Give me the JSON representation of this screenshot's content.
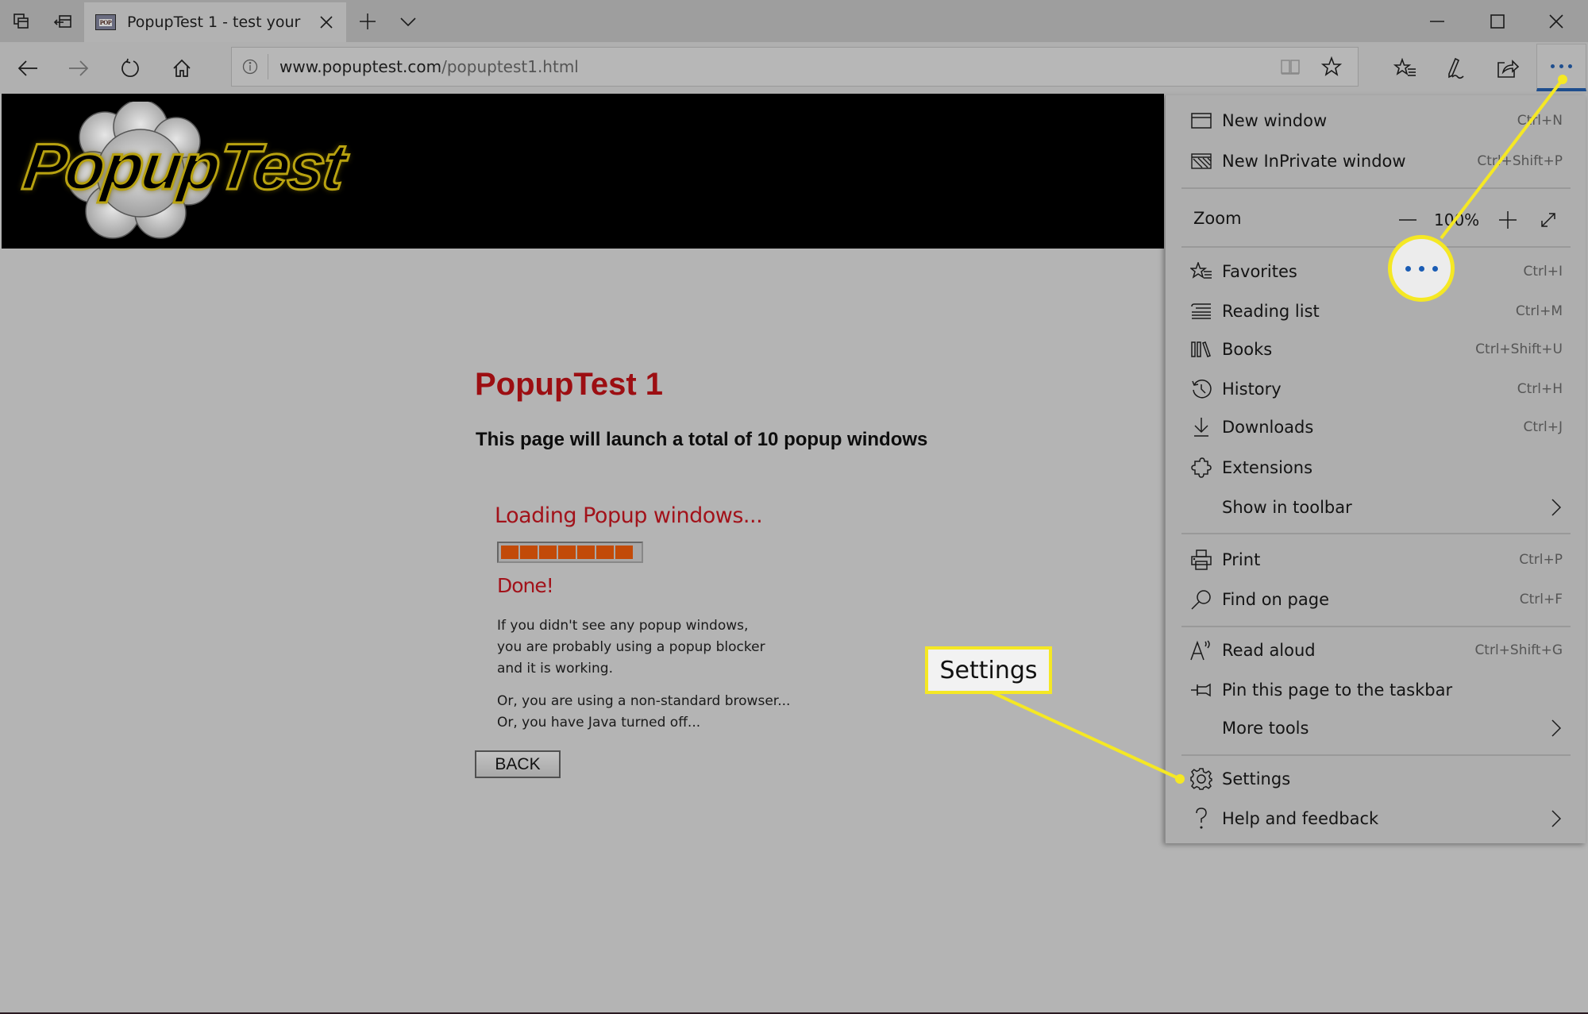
{
  "browser": {
    "tab": {
      "favicon_text": "POP",
      "title": "PopupTest 1 - test your"
    },
    "address": {
      "domain": "www.popuptest.com",
      "path": "/popuptest1.html"
    },
    "icons": {
      "tab_actions": "tab-actions-icon",
      "set_aside": "set-aside-tabs-icon",
      "new_tab": "plus-icon",
      "tab_list": "chevron-down-icon",
      "minimize": "minimize-icon",
      "maximize": "maximize-icon",
      "close": "close-icon",
      "back": "back-arrow-icon",
      "forward": "forward-arrow-icon",
      "refresh": "refresh-icon",
      "home": "home-icon",
      "site_info": "info-icon",
      "reading_view": "reading-view-icon",
      "favorite": "star-icon",
      "favorites_hub": "favorites-list-icon",
      "web_note": "pen-icon",
      "share": "share-icon",
      "more": "more-dots-icon"
    },
    "accent_color": "#1e4e8e"
  },
  "page": {
    "logo_text": "PopupTest",
    "title": "PopupTest 1",
    "subtitle": "This page will launch a total of 10 popup windows",
    "loading_text": "Loading Popup windows...",
    "progress": {
      "filled_segments": 7,
      "total_segments": 7,
      "percent": 100
    },
    "done_text": "Done!",
    "paragraph1": [
      "If you didn't see any popup windows,",
      "you are probably using a popup blocker",
      "and it is working."
    ],
    "paragraph2": [
      "Or, you are using a non-standard browser...",
      "Or, you have Java turned off..."
    ],
    "back_button": "BACK",
    "title_color": "#9c0e12"
  },
  "menu": {
    "items": [
      {
        "label": "New window",
        "shortcut": "Ctrl+N",
        "icon": "new-window-icon"
      },
      {
        "label": "New InPrivate window",
        "shortcut": "Ctrl+Shift+P",
        "icon": "inprivate-window-icon"
      },
      {
        "label": "Favorites",
        "shortcut": "Ctrl+I",
        "icon": "favorites-icon"
      },
      {
        "label": "Reading list",
        "shortcut": "Ctrl+M",
        "icon": "reading-list-icon"
      },
      {
        "label": "Books",
        "shortcut": "Ctrl+Shift+U",
        "icon": "books-icon"
      },
      {
        "label": "History",
        "shortcut": "Ctrl+H",
        "icon": "history-icon"
      },
      {
        "label": "Downloads",
        "shortcut": "Ctrl+J",
        "icon": "download-icon"
      },
      {
        "label": "Extensions",
        "shortcut": "",
        "icon": "puzzle-icon"
      },
      {
        "label": "Show in toolbar",
        "shortcut": "",
        "icon": "",
        "submenu": true
      },
      {
        "label": "Print",
        "shortcut": "Ctrl+P",
        "icon": "print-icon"
      },
      {
        "label": "Find on page",
        "shortcut": "Ctrl+F",
        "icon": "search-icon"
      },
      {
        "label": "Read aloud",
        "shortcut": "Ctrl+Shift+G",
        "icon": "read-aloud-icon"
      },
      {
        "label": "Pin this page to the taskbar",
        "shortcut": "",
        "icon": "pin-icon"
      },
      {
        "label": "More tools",
        "shortcut": "",
        "icon": "",
        "submenu": true
      },
      {
        "label": "Settings",
        "shortcut": "",
        "icon": "gear-icon"
      },
      {
        "label": "Help and feedback",
        "shortcut": "",
        "icon": "question-icon",
        "submenu": true
      }
    ],
    "zoom": {
      "label": "Zoom",
      "value": "100%"
    }
  },
  "annotations": {
    "callout_label": "Settings",
    "highlight_color": "#f5e824"
  }
}
